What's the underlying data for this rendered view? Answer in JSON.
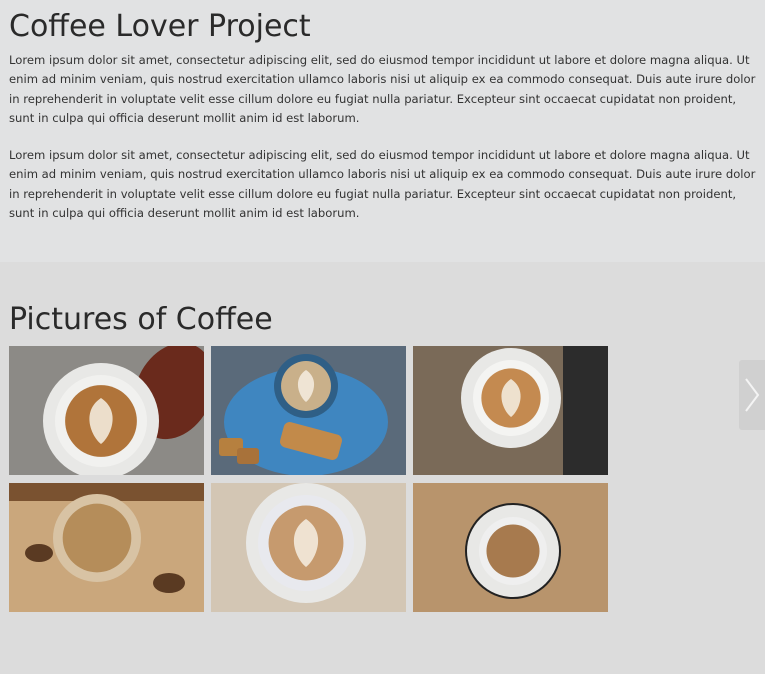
{
  "intro": {
    "title": "Coffee Lover Project",
    "paragraphs": [
      "Lorem ipsum dolor sit amet, consectetur adipiscing elit, sed do eiusmod tempor incididunt ut labore et dolore magna aliqua. Ut enim ad minim veniam, quis nostrud exercitation ullamco laboris nisi ut aliquip ex ea commodo consequat. Duis aute irure dolor in reprehenderit in voluptate velit esse cillum dolore eu fugiat nulla pariatur. Excepteur sint occaecat cupidatat non proident, sunt in culpa qui officia deserunt mollit anim id est laborum.",
      "Lorem ipsum dolor sit amet, consectetur adipiscing elit, sed do eiusmod tempor incididunt ut labore et dolore magna aliqua. Ut enim ad minim veniam, quis nostrud exercitation ullamco laboris nisi ut aliquip ex ea commodo consequat. Duis aute irure dolor in reprehenderit in voluptate velit esse cillum dolore eu fugiat nulla pariatur. Excepteur sint occaecat cupidatat non proident, sunt in culpa qui officia deserunt mollit anim id est laborum."
    ]
  },
  "gallery": {
    "title": "Pictures of Coffee",
    "photos": [
      {
        "name": "latte-art-with-autumn-leaf",
        "bg": "#8c8a86",
        "cup": "#f1f1ef",
        "coffee": "#b0743a",
        "accent": "#6a2a1c"
      },
      {
        "name": "blue-cup-with-biscotti",
        "bg": "#5a6a7a",
        "cup": "#3f86c0",
        "coffee": "#c9b08a",
        "accent": "#c28a4a"
      },
      {
        "name": "cappuccino-on-wood-table",
        "bg": "#7a6a58",
        "cup": "#f4f4f2",
        "coffee": "#c48a50",
        "accent": "#2c2c2c"
      },
      {
        "name": "coffee-cup-on-rustic-wood",
        "bg": "#caa77c",
        "cup": "#d8c3a4",
        "coffee": "#b58d5a",
        "accent": "#5a3a22"
      },
      {
        "name": "latte-art-rosetta",
        "bg": "#d3c6b4",
        "cup": "#e8e9ee",
        "coffee": "#c69a6e",
        "accent": "#f6f1ea"
      },
      {
        "name": "espresso-cup-with-spoon",
        "bg": "#b8946c",
        "cup": "#efefef",
        "coffee": "#a77a4e",
        "accent": "#222222"
      }
    ]
  },
  "carousel": {
    "next_icon": "chevron-right-icon"
  }
}
